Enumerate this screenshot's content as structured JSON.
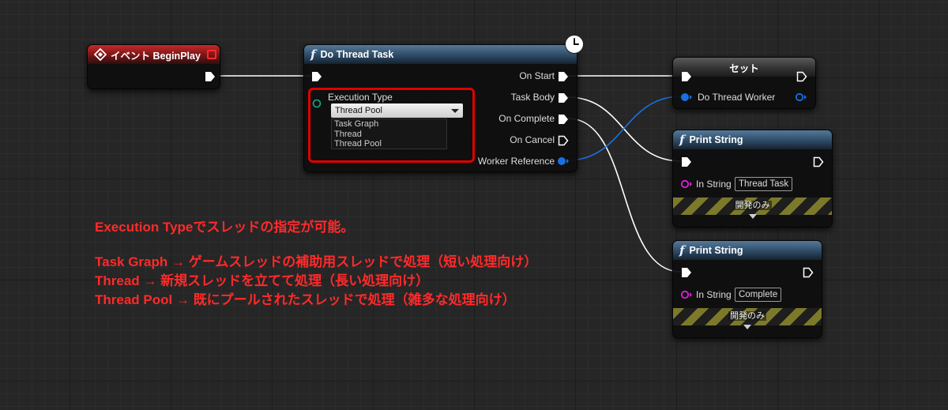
{
  "colors": {
    "event_header": "#8f1a1a",
    "function_header": "#2d4a66",
    "variable_header": "#3a3a3a",
    "exec_pin": "#ffffff",
    "worker_pin": "#1a6fe0",
    "string_pin": "#e01ee0",
    "annotation_text": "#ff2a2a",
    "highlight_box": "#e00000"
  },
  "event_node": {
    "title": "イベント BeginPlay",
    "icon": "event-diamond-icon"
  },
  "task_node": {
    "title": "Do Thread Task",
    "icon": "function-f-icon",
    "badge_icon": "clock-icon",
    "execution_type_label": "Execution Type",
    "execution_type_value": "Thread Pool",
    "options": [
      "Task Graph",
      "Thread",
      "Thread Pool"
    ],
    "outputs": {
      "on_start": "On Start",
      "task_body": "Task Body",
      "on_complete": "On Complete",
      "on_cancel": "On Cancel",
      "worker_reference": "Worker Reference"
    }
  },
  "set_node": {
    "title": "セット",
    "variable_label": "Do Thread Worker"
  },
  "print_node_1": {
    "title": "Print String",
    "in_string_label": "In String",
    "in_string_value": "Thread Task",
    "dev_only_label": "開発のみ"
  },
  "print_node_2": {
    "title": "Print String",
    "in_string_label": "In String",
    "in_string_value": "Complete",
    "dev_only_label": "開発のみ"
  },
  "annotation": {
    "line1": "Execution Typeでスレッドの指定が可能。",
    "line2": "Task Graph → ゲームスレッドの補助用スレッドで処理（短い処理向け）",
    "line3": "Thread → 新規スレッドを立てて処理（長い処理向け）",
    "line4": "Thread Pool → 既にプールされたスレッドで処理（雑多な処理向け）"
  }
}
